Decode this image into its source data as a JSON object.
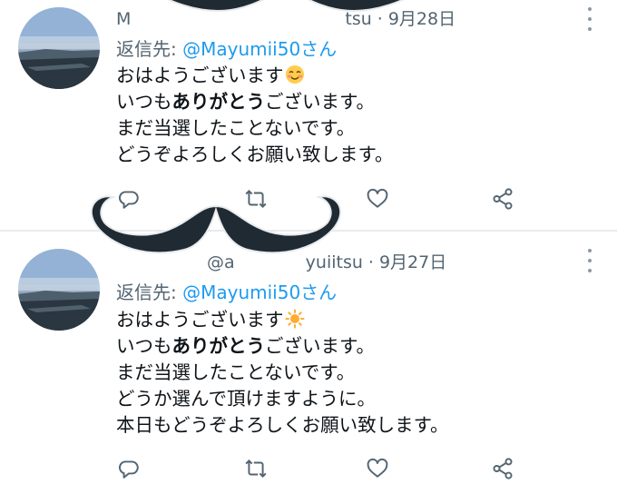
{
  "tweets": [
    {
      "handle": "M",
      "handle_tail": "tsu",
      "separator": "·",
      "date": "9月28日",
      "reply_prefix": "返信先: ",
      "reply_mention": "@Mayumii50さん",
      "lines": [
        {
          "pre": "おはようございます",
          "bold": "",
          "post": "",
          "emoji": "smiling-face-emoji"
        },
        {
          "pre": "いつも",
          "bold": "ありがとう",
          "post": "ございます。",
          "emoji": ""
        },
        {
          "pre": "まだ当選したことないです。",
          "bold": "",
          "post": "",
          "emoji": ""
        },
        {
          "pre": "どうぞよろしくお願い致します。",
          "bold": "",
          "post": "",
          "emoji": ""
        }
      ]
    },
    {
      "handle": "@a",
      "handle_tail": "yuiitsu",
      "separator": "·",
      "date": "9月27日",
      "reply_prefix": "返信先: ",
      "reply_mention": "@Mayumii50さん",
      "lines": [
        {
          "pre": "おはようございます",
          "bold": "",
          "post": "",
          "emoji": "sun-emoji"
        },
        {
          "pre": "いつも",
          "bold": "ありがとう",
          "post": "ございます。",
          "emoji": ""
        },
        {
          "pre": "まだ当選したことないです。",
          "bold": "",
          "post": "",
          "emoji": ""
        },
        {
          "pre": "どうか選んで頂けますように。",
          "bold": "",
          "post": "",
          "emoji": ""
        },
        {
          "pre": "本日もどうぞよろしくお願い致します。",
          "bold": "",
          "post": "",
          "emoji": ""
        }
      ]
    }
  ],
  "icons": {
    "more": "more-vertical-icon",
    "reply": "reply-icon",
    "retweet": "retweet-icon",
    "like": "heart-icon",
    "share": "share-icon"
  },
  "colors": {
    "text": "#0f1419",
    "secondary": "#536471",
    "mention": "#1d9bf0",
    "icon": "#536471",
    "mustache": "#1f2a33"
  }
}
